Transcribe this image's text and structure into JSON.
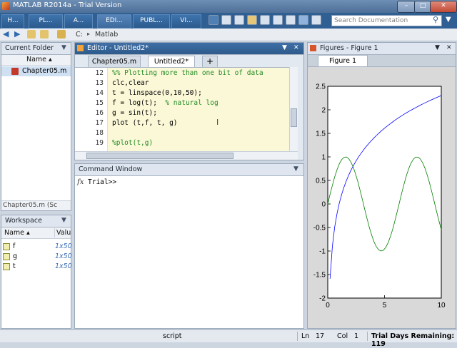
{
  "window": {
    "title": "MATLAB R2014a - Trial Version"
  },
  "ribbon": {
    "tabs": [
      "H...",
      "PL...",
      "A...",
      "EDI...",
      "PUBL...",
      "VI..."
    ],
    "search_placeholder": "Search Documentation"
  },
  "address": {
    "drive": "C:",
    "separator": "▸",
    "folder": "Matlab"
  },
  "current_folder": {
    "title": "Current Folder",
    "column": "Name ▴",
    "files": [
      "Chapter05.m"
    ],
    "details": "Chapter05.m (Sc"
  },
  "workspace": {
    "title": "Workspace",
    "col_name": "Name ▴",
    "col_value": "Valu",
    "vars": [
      {
        "name": "f",
        "value": "1x50"
      },
      {
        "name": "g",
        "value": "1x50"
      },
      {
        "name": "t",
        "value": "1x50"
      }
    ]
  },
  "editor": {
    "title": "Editor - Untitled2*",
    "tabs": [
      "Chapter05.m",
      "Untitled2*"
    ],
    "add_tab": "+",
    "lines": [
      {
        "num": "12",
        "text": "%% Plotting more than one bit of data",
        "comment": ""
      },
      {
        "num": "13",
        "text": "clc,clear",
        "comment": ""
      },
      {
        "num": "14",
        "text": "t = linspace(0,10,50);",
        "comment": ""
      },
      {
        "num": "15",
        "text": "f = log(t);  ",
        "comment": "% natural log"
      },
      {
        "num": "16",
        "text": "g = sin(t);",
        "comment": ""
      },
      {
        "num": "17",
        "text": "plot (t,f, t, g)",
        "comment": ""
      },
      {
        "num": "18",
        "text": "",
        "comment": ""
      },
      {
        "num": "19",
        "text": "",
        "comment": "%plot(t,g)"
      }
    ]
  },
  "command_window": {
    "title": "Command Window",
    "fx": "fx",
    "prompt": "Trial>>"
  },
  "figures": {
    "title": "Figures - Figure 1",
    "tab": "Figure 1",
    "chart_data": {
      "type": "line",
      "xlim": [
        0,
        10
      ],
      "ylim": [
        -2,
        2.5
      ],
      "xticks": [
        "0",
        "5",
        "10"
      ],
      "yticks": [
        "2.5",
        "2",
        "1.5",
        "1",
        "0.5",
        "0",
        "-0.5",
        "-1",
        "-1.5",
        "-2"
      ],
      "series": [
        {
          "color": "#0000ff",
          "fn": "log",
          "x_range": [
            0.2041,
            10
          ],
          "points": 49
        },
        {
          "color": "#008000",
          "fn": "sin",
          "x_range": [
            0,
            10
          ],
          "points": 50
        }
      ]
    }
  },
  "status": {
    "mode": "script",
    "ln_label": "Ln",
    "ln": "17",
    "col_label": "Col",
    "col": "1",
    "trial": "Trial Days Remaining: 119"
  }
}
